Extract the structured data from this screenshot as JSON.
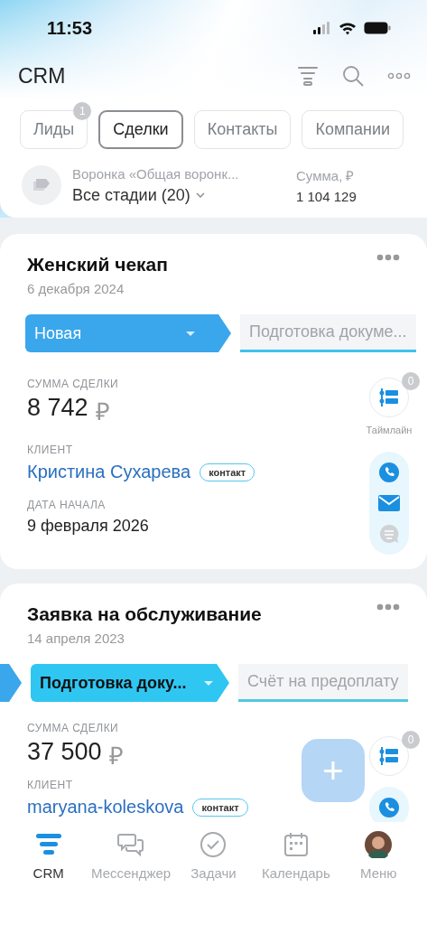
{
  "status_bar": {
    "time": "11:53"
  },
  "header": {
    "title": "CRM"
  },
  "tabs": [
    {
      "label": "Лиды",
      "selected": false,
      "badge": "1"
    },
    {
      "label": "Сделки",
      "selected": true
    },
    {
      "label": "Контакты",
      "selected": false
    },
    {
      "label": "Компании",
      "selected": false
    }
  ],
  "funnel": {
    "name": "Воронка «Общая воронк...",
    "stages": "Все стадии (20)",
    "sum_label": "Сумма, ₽",
    "sum": "1 104 129"
  },
  "deals": [
    {
      "title": "Женский чекап",
      "date": "6 декабря 2024",
      "stages": [
        {
          "kind": "current",
          "label": "Новая",
          "color": "#3aa6ec"
        },
        {
          "kind": "next",
          "label": "Подготовка докуме...",
          "color": "#3fc1ee"
        }
      ],
      "fields": [
        {
          "kind": "amount",
          "label": "СУММА СДЕЛКИ",
          "value": "8 742",
          "currency": "₽"
        },
        {
          "kind": "client",
          "label": "КЛИЕНТ",
          "value": "Кристина Сухарева",
          "tag": "контакт"
        },
        {
          "kind": "text",
          "label": "ДАТА НАЧАЛА",
          "value": "9 февраля 2026"
        }
      ],
      "timeline": {
        "count": "0",
        "label": "Таймлайн"
      },
      "actions": [
        {
          "kind": "phone",
          "disabled": false
        },
        {
          "kind": "mail",
          "disabled": false
        },
        {
          "kind": "chat",
          "disabled": true
        }
      ]
    },
    {
      "title": "Заявка на обслуживание",
      "date": "14 апреля 2023",
      "stages": [
        {
          "kind": "previous",
          "color": "#3aa6ec"
        },
        {
          "kind": "current",
          "label": "Подготовка доку...",
          "color": "#2fc6f2"
        },
        {
          "kind": "next",
          "label": "Счёт на предоплату",
          "color": "#4fcadb"
        }
      ],
      "fields": [
        {
          "kind": "amount",
          "label": "СУММА СДЕЛКИ",
          "value": "37 500",
          "currency": "₽"
        },
        {
          "kind": "client",
          "label": "КЛИЕНТ",
          "value": "maryana-koleskova",
          "tag": "контакт"
        }
      ],
      "timeline": {
        "count": "0"
      },
      "actions": [
        {
          "kind": "phone",
          "disabled": false
        }
      ]
    }
  ],
  "fab": {
    "label": "+"
  },
  "nav": [
    {
      "kind": "crm",
      "label": "CRM",
      "selected": true
    },
    {
      "kind": "messenger",
      "label": "Мессенджер",
      "selected": false
    },
    {
      "kind": "tasks",
      "label": "Задачи",
      "selected": false
    },
    {
      "kind": "calendar",
      "label": "Календарь",
      "selected": false
    },
    {
      "kind": "avatar",
      "label": "Меню",
      "selected": false
    }
  ]
}
